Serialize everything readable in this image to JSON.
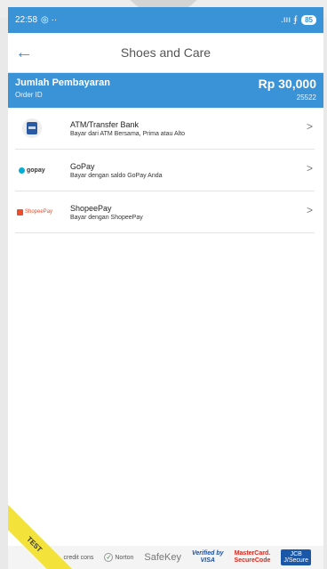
{
  "status": {
    "time": "22:58",
    "icons_left": "◎ ··",
    "signal": ".ııı ⨎",
    "battery": "85"
  },
  "appbar": {
    "title": "Shoes and Care",
    "back_icon": "arrow-left-icon"
  },
  "summary": {
    "amount_label": "Jumlah Pembayaran",
    "amount_value": "Rp 30,000",
    "order_label": "Order ID",
    "order_value": "25522"
  },
  "methods": [
    {
      "name": "ATM/Transfer Bank",
      "desc": "Bayar dari ATM Bersama, Prima atau Alto"
    },
    {
      "name": "GoPay",
      "desc": "Bayar dengan saldo GoPay Anda",
      "logo_text": "gopay"
    },
    {
      "name": "ShopeePay",
      "desc": "Bayar dengan ShopeePay",
      "logo_text": "ShopeePay"
    }
  ],
  "chevron": ">",
  "footer": {
    "test_label": "TEST",
    "creditcard_label": "credit cons",
    "norton_label": "Norton",
    "safekey_label": "SafeKey",
    "visa_label_1": "Verified by",
    "visa_label_2": "VISA",
    "mc_label_1": "MasterCard.",
    "mc_label_2": "SecureCode",
    "jcb_label_1": "JCB",
    "jcb_label_2": "J/Secure"
  },
  "colors": {
    "accent": "#3a93d6",
    "ribbon": "#f2e23a"
  }
}
